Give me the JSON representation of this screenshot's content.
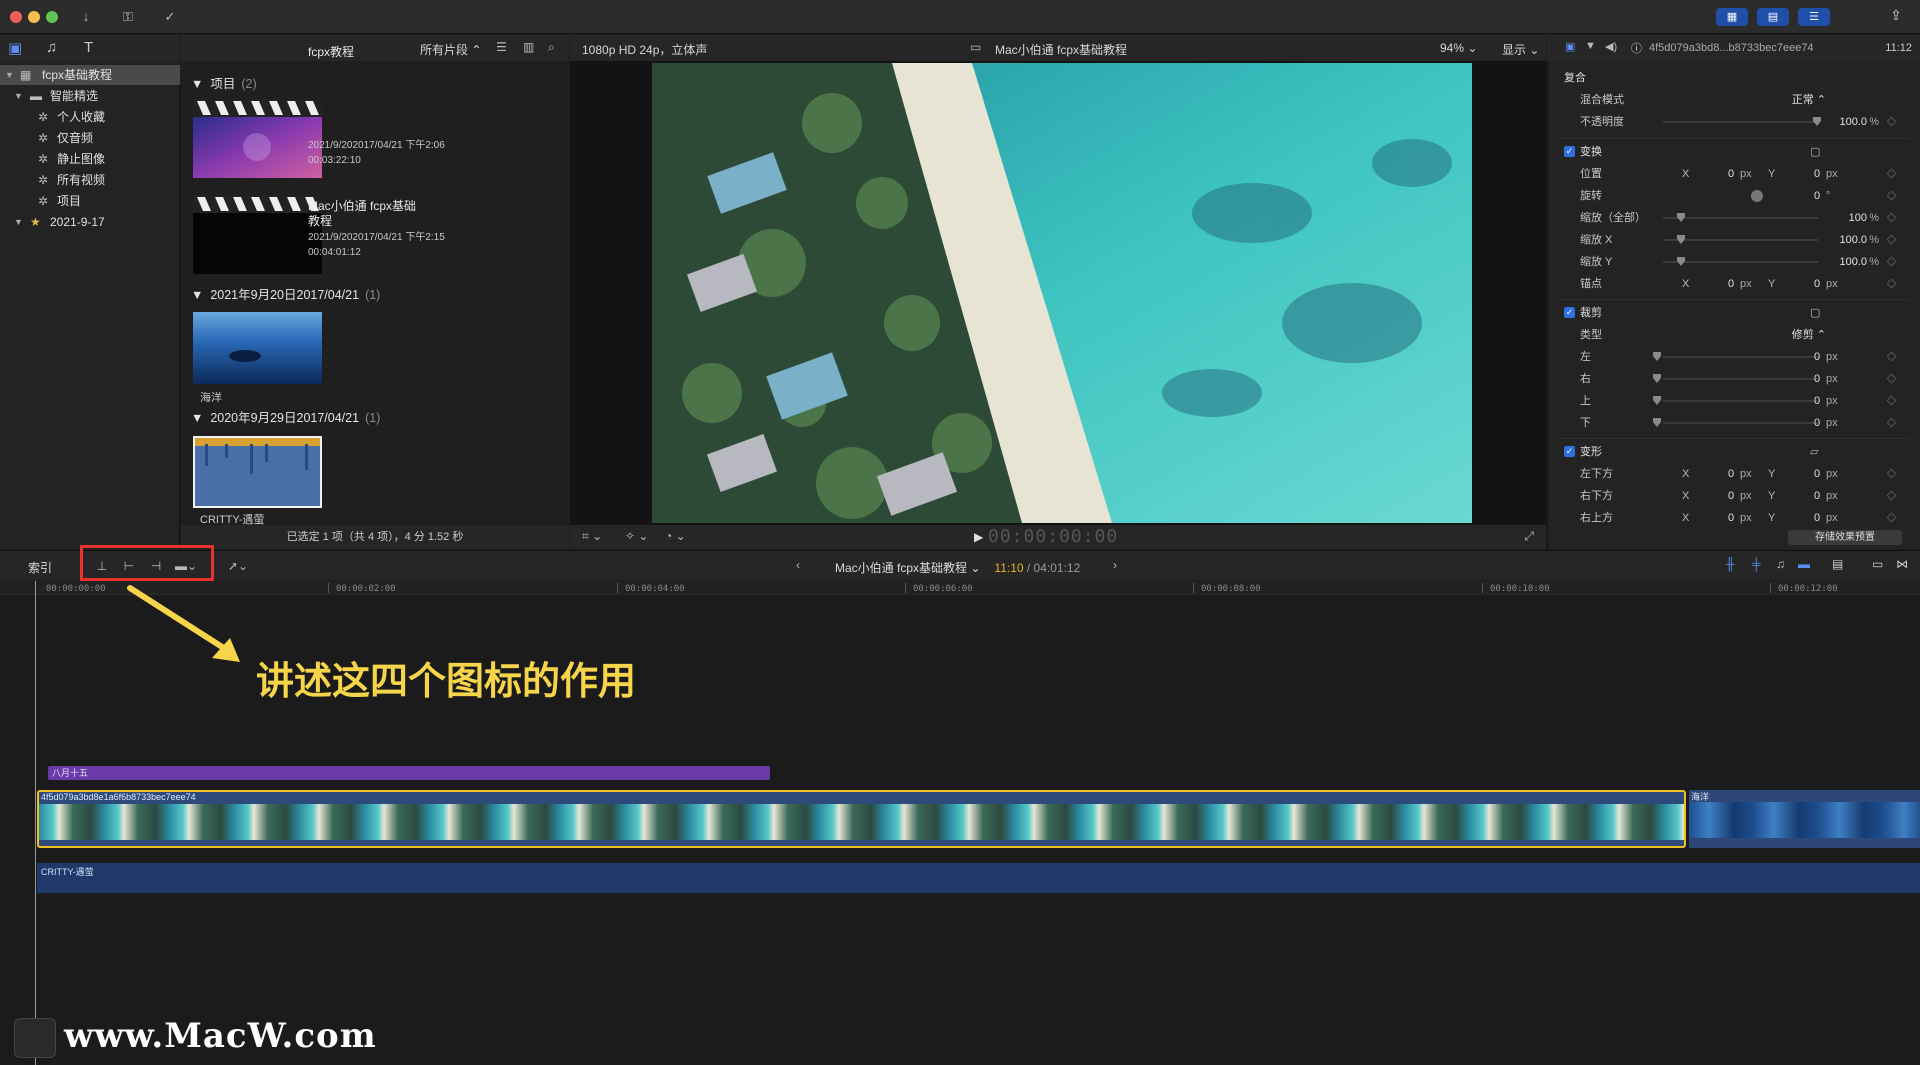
{
  "colors": {
    "accent_blue": "#2f6fe0",
    "selection_yellow": "#f0c020",
    "annotation_yellow": "#f7d54a",
    "highlight_red": "#e8332c",
    "title_clip_purple": "#6a3aa8"
  },
  "titlebar": {
    "download_icon": "download-icon",
    "key_icon": "key-icon",
    "check_icon": "check-circle-icon"
  },
  "library": {
    "items": [
      {
        "label": "fcpx基础教程",
        "icon": "library-grid-icon"
      },
      {
        "label": "智能精选",
        "icon": "folder-icon"
      },
      {
        "label": "个人收藏",
        "icon": "gear-icon"
      },
      {
        "label": "仅音频",
        "icon": "gear-icon"
      },
      {
        "label": "静止图像",
        "icon": "gear-icon"
      },
      {
        "label": "所有视频",
        "icon": "gear-icon"
      },
      {
        "label": "项目",
        "icon": "gear-icon"
      },
      {
        "label": "2021-9-17",
        "icon": "event-star-icon"
      }
    ]
  },
  "browser": {
    "filter": "所有片段",
    "sections": [
      {
        "title": "项目",
        "count": "(2)"
      },
      {
        "title": "2021年9月20日2017/04/21",
        "count": "(1)"
      },
      {
        "title": "2020年9月29日2017/04/21",
        "count": "(1)"
      }
    ],
    "clips": [
      {
        "title": "fcpx教程",
        "date": "2021/9/202017/04/21 下午2:06",
        "duration": "00:03:22:10"
      },
      {
        "title": "Mac小伯通 fcpx基础",
        "title2": "教程",
        "date": "2021/9/202017/04/21 下午2:15",
        "duration": "00:04:01:12"
      },
      {
        "title": "海洋"
      },
      {
        "title": "CRITTY-遇萤"
      }
    ],
    "status": "已选定 1 项（共 4 项），4 分 1.52 秒"
  },
  "viewer": {
    "format": "1080p HD 24p，立体声",
    "project": "Mac小伯通 fcpx基础教程",
    "zoom": "94%",
    "display": "显示",
    "timecode": "00:00:00:00"
  },
  "inspector": {
    "clip_id": "4f5d079a3bd8...b8733bec7eee74",
    "time": "11:12",
    "composite": "复合",
    "blend_mode_label": "混合模式",
    "blend_mode": "正常",
    "opacity_label": "不透明度",
    "opacity": "100.0",
    "transform": "变换",
    "position_label": "位置",
    "pos_x": "0",
    "pos_y": "0",
    "rotation_label": "旋转",
    "rotation": "0",
    "scale_all_label": "缩放（全部）",
    "scale_all": "100",
    "scale_x_label": "缩放 X",
    "scale_x": "100.0",
    "scale_y_label": "缩放 Y",
    "scale_y": "100.0",
    "anchor_label": "锚点",
    "anchor_x": "0",
    "anchor_y": "0",
    "crop": "裁剪",
    "type_label": "类型",
    "type": "修剪",
    "left_label": "左",
    "left": "0",
    "right_label": "右",
    "right": "0",
    "top_label": "上",
    "top": "0",
    "bottom_label": "下",
    "bottom": "0",
    "distort": "变形",
    "bl_label": "左下方",
    "bl_x": "0",
    "bl_y": "0",
    "br_label": "右下方",
    "br_x": "0",
    "br_y": "0",
    "tr_label": "右上方",
    "tr_x": "0",
    "tr_y": "0",
    "unit_px": "px",
    "unit_pct": "%",
    "unit_deg": "°",
    "x": "X",
    "y": "Y",
    "save_preset": "存储效果预置"
  },
  "timeline": {
    "index": "索引",
    "project": "Mac小伯通 fcpx基础教程",
    "current": "11:10",
    "total": "/ 04:01:12",
    "ticks": [
      "00:00:00:00",
      "00:00:02:00",
      "00:00:04:00",
      "00:00:06:00",
      "00:00:08:00",
      "00:00:10:00",
      "00:00:12:00"
    ],
    "title_clip": "八月十五",
    "video_clip": "4f5d079a3bd8e1a6f6b8733bec7eee74",
    "ocean_clip": "海洋",
    "audio_clip": "CRITTY-遇萤"
  },
  "annotation": {
    "text": "讲述这四个图标的作用"
  },
  "watermark": "www.MacW.com"
}
